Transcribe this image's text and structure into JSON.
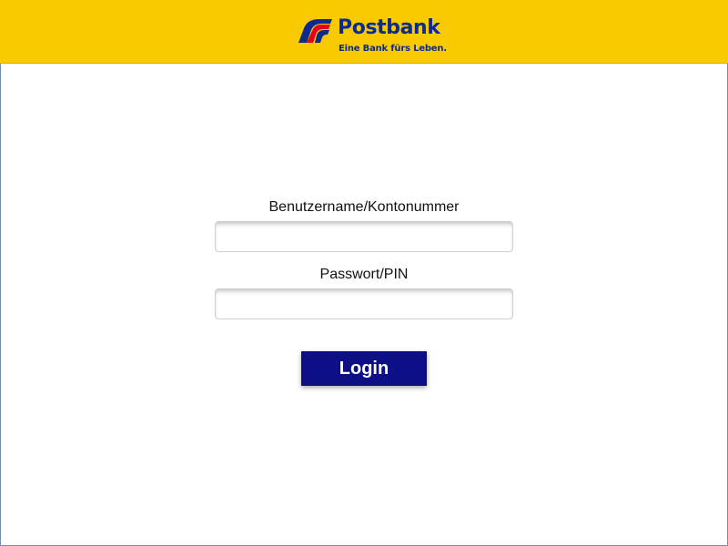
{
  "header": {
    "brand_name": "Postbank",
    "tagline": "Eine Bank fürs Leben.",
    "logo_icon": "postbank-logo-icon",
    "colors": {
      "header_background": "#FACA00",
      "brand_blue": "#0B2B8F",
      "logo_red": "#E3001B"
    }
  },
  "login_form": {
    "username_label": "Benutzername/Kontonummer",
    "username_value": "",
    "password_label": "Passwort/PIN",
    "password_value": "",
    "submit_label": "Login",
    "submit_color": "#0C0F86"
  }
}
